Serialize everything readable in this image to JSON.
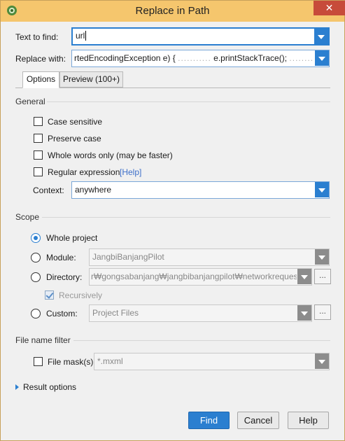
{
  "window": {
    "title": "Replace in Path",
    "close_glyph": "✕"
  },
  "find": {
    "label": "Text to find:",
    "value": "url"
  },
  "replace": {
    "label": "Replace with:",
    "value_start": "rtedEncodingException e) {",
    "value_mid": "e.printStackTrace();",
    "value_end": "}",
    "ellipsis": "..........."
  },
  "tabs": [
    {
      "label": "Options"
    },
    {
      "label": "Preview (100+)"
    }
  ],
  "general": {
    "heading": "General",
    "options": [
      {
        "label": "Case sensitive",
        "checked": false
      },
      {
        "label": "Preserve case",
        "checked": false
      },
      {
        "label": "Whole words only (may be faster)",
        "checked": false
      },
      {
        "label": "Regular expression",
        "checked": false
      }
    ],
    "help_link": "[Help]",
    "context_label": "Context:",
    "context_value": "anywhere"
  },
  "scope": {
    "heading": "Scope",
    "whole_project": "Whole project",
    "module_label": "Module:",
    "module_value": "JangbiBanjangPilot",
    "directory_label": "Directory:",
    "directory_value": "r₩gongsabanjang₩jangbibanjangpilot₩networkrequest",
    "recursively": "Recursively",
    "custom_label": "Custom:",
    "custom_value": "Project Files",
    "browse_glyph": "...",
    "selected": "Whole project"
  },
  "file_filter": {
    "heading": "File name filter",
    "mask_label": "File mask(s)",
    "mask_value": "*.mxml"
  },
  "result_options": "Result options",
  "buttons": {
    "find": "Find",
    "cancel": "Cancel",
    "help": "Help"
  },
  "colors": {
    "titlebar": "#f5c66d",
    "accent": "#2b7fd0",
    "close": "#c74b3a",
    "link": "#3d6fc9"
  }
}
